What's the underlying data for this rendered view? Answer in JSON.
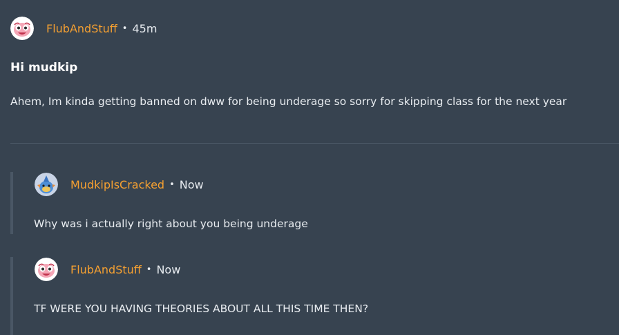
{
  "post": {
    "author": "FlubAndStuff",
    "separator": "•",
    "time": "45m",
    "title": "Hi mudkip",
    "body": "Ahem, Im kinda getting banned on dww for being underage so sorry for skipping class for the next year"
  },
  "replies": [
    {
      "author": "MudkipIsCracked",
      "separator": "•",
      "time": "Now",
      "body": "Why was i actually right about you being underage"
    },
    {
      "author": "FlubAndStuff",
      "separator": "•",
      "time": "Now",
      "body": "TF WERE YOU HAVING THEORIES ABOUT ALL THIS TIME THEN?"
    }
  ],
  "colors": {
    "background": "#374350",
    "author": "#f5a031",
    "text": "#e8ecf0",
    "divider": "#4b5866",
    "reply_bar": "#4a5765"
  },
  "icons": {
    "post_avatar": "pink-blob-avatar-icon",
    "reply_1_avatar": "mudkip-avatar-icon",
    "reply_2_avatar": "pink-blob-avatar-icon"
  }
}
